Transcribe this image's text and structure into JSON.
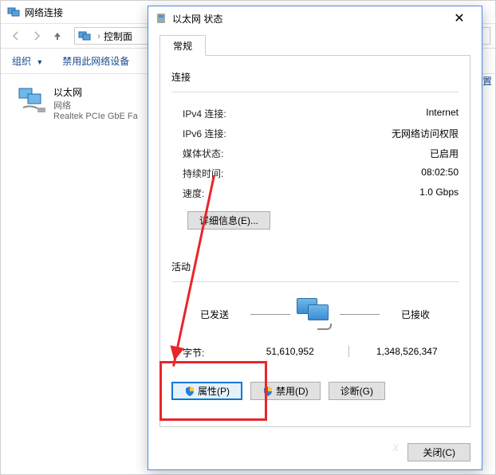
{
  "bg": {
    "title": "网络连接",
    "breadcrumb": "控制面",
    "organize": "组织",
    "organize_arrow": "▼",
    "disable_device": "禁用此网络设备",
    "right_cmd": "设置",
    "conn": {
      "name": "以太网",
      "status": "网络",
      "adapter": "Realtek PCIe GbE Fa"
    }
  },
  "dlg": {
    "title": "以太网 状态",
    "tab_general": "常规",
    "sec_connection": "连接",
    "rows": {
      "ipv4_lbl": "IPv4 连接:",
      "ipv4_val": "Internet",
      "ipv6_lbl": "IPv6 连接:",
      "ipv6_val": "无网络访问权限",
      "media_lbl": "媒体状态:",
      "media_val": "已启用",
      "duration_lbl": "持续时间:",
      "duration_val": "08:02:50",
      "speed_lbl": "速度:",
      "speed_val": "1.0 Gbps"
    },
    "details_btn": "详细信息(E)...",
    "sec_activity": "活动",
    "sent_lbl": "已发送",
    "recv_lbl": "已接收",
    "bytes_lbl": "字节:",
    "bytes_sent": "51,610,952",
    "bytes_recv": "1,348,526,347",
    "btn_props": "属性(P)",
    "btn_disable": "禁用(D)",
    "btn_diag": "诊断(G)",
    "btn_close": "关闭(C)"
  }
}
